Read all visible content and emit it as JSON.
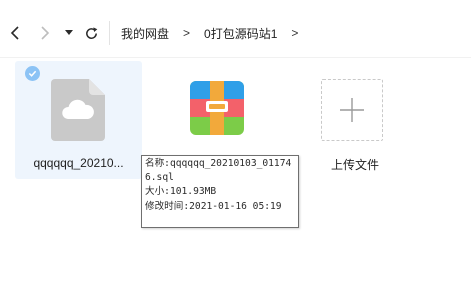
{
  "toolbar": {
    "back_icon": "chevron-left-icon",
    "forward_icon": "chevron-right-icon",
    "history_icon": "caret-down-icon",
    "refresh_icon": "refresh-icon",
    "breadcrumb": {
      "root": "我的网盘",
      "separator": ">",
      "current": "0打包源码站1"
    }
  },
  "files": [
    {
      "name": "qqqqqq_20210...",
      "icon": "cloud-document-icon",
      "selected": true
    },
    {
      "name": "",
      "icon": "archive-zip-icon",
      "selected": false
    }
  ],
  "upload": {
    "label": "上传文件",
    "icon": "plus-icon"
  },
  "tooltip": {
    "name_line": "名称:qqqqqq_20210103_011746.sql",
    "size_line": "大小:101.93MB",
    "modified_line": "修改时间:2021-01-16 05:19"
  },
  "colors": {
    "selection_bg": "#eef5fd",
    "check_badge": "#8cc3f5",
    "zip_blue": "#2f9fe8",
    "zip_red": "#f3616a",
    "zip_green": "#7ccc48",
    "zip_band": "#f2a93b"
  }
}
